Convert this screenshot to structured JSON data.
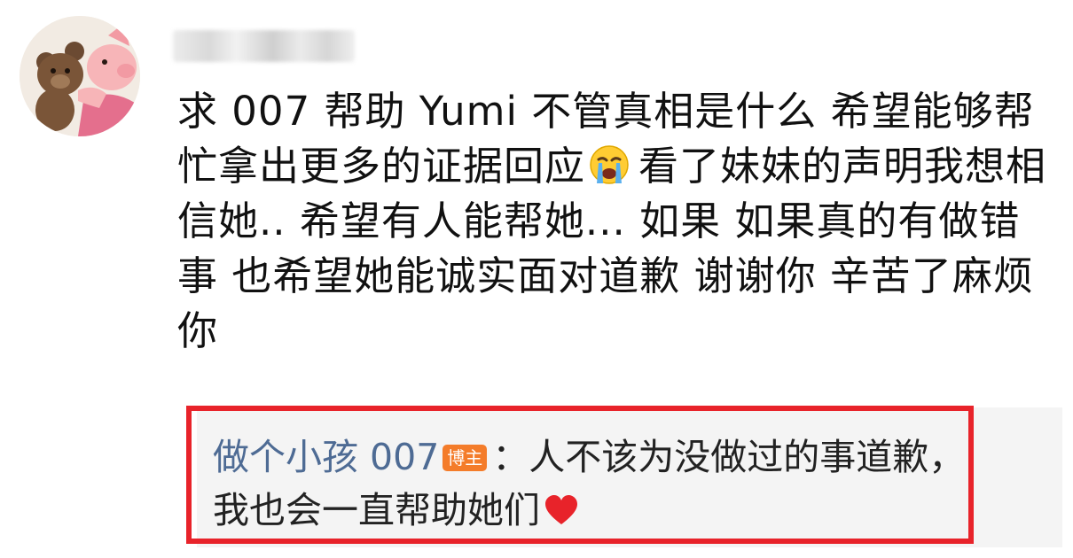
{
  "comment": {
    "text_part1": "求 007 帮助 Yumi 不管真相是什么 希望能够帮忙拿出更多的证据回应",
    "emoji_after_part1": "loudly-crying-face",
    "text_part2": "看了妹妹的声明我想相信她.. 希望有人能帮她... 如果 如果真的有做错事 也希望她能诚实面对道歉 谢谢你 辛苦了麻烦你"
  },
  "reply": {
    "author": "做个小孩 007",
    "badge": "博主",
    "separator": "：",
    "text": "人不该为没做过的事道歉，我也会一直帮助她们",
    "emoji_after_text": "red-heart"
  },
  "colors": {
    "highlight_border": "#e8232a",
    "author_link": "#4e6b94",
    "badge_bg": "#f47c2a",
    "reply_bg": "#f4f4f4"
  }
}
